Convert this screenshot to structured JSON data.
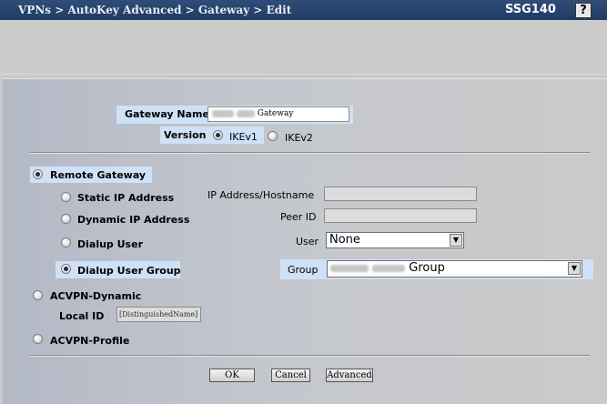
{
  "header": {
    "breadcrumb": "VPNs > AutoKey Advanced > Gateway > Edit",
    "product": "SSG140",
    "help_glyph": "?"
  },
  "gateway_name": {
    "label": "Gateway Name",
    "value": "Gateway"
  },
  "version": {
    "label": "Version",
    "options": [
      "IKEv1",
      "IKEv2"
    ],
    "selected": "IKEv1"
  },
  "remote_gateway": {
    "label": "Remote Gateway",
    "selected": true,
    "types": [
      "Static IP Address",
      "Dynamic IP Address",
      "Dialup User",
      "Dialup User Group"
    ],
    "selected_type": "Dialup User Group",
    "fields": {
      "ip_label": "IP Address/Hostname",
      "peer_label": "Peer ID",
      "user_label": "User",
      "user_value": "None",
      "group_label": "Group",
      "group_value": "Group"
    }
  },
  "acvpn_dynamic": {
    "label": "ACVPN-Dynamic",
    "local_id_label": "Local ID",
    "local_id_value": "[DistinguishedName]"
  },
  "acvpn_profile": {
    "label": "ACVPN-Profile"
  },
  "buttons": {
    "ok": "OK",
    "cancel": "Cancel",
    "advanced": "Advanced"
  },
  "colors": {
    "titlebar": "#203a63",
    "highlight": "#cfe1f7"
  }
}
